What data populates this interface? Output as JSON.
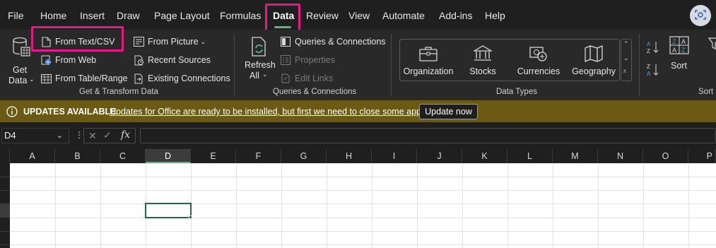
{
  "menu": {
    "tabs": [
      "File",
      "Home",
      "Insert",
      "Draw",
      "Page Layout",
      "Formulas",
      "Data",
      "Review",
      "View",
      "Automate",
      "Add-ins",
      "Help"
    ],
    "active_tab": "Data"
  },
  "ribbon": {
    "get_transform": {
      "get_data_line1": "Get",
      "get_data_line2": "Data",
      "from_text_csv": "From Text/CSV",
      "from_web": "From Web",
      "from_table_range": "From Table/Range",
      "from_picture": "From Picture",
      "recent_sources": "Recent Sources",
      "existing_connections": "Existing Connections",
      "group_label": "Get & Transform Data"
    },
    "queries": {
      "refresh_line1": "Refresh",
      "refresh_line2": "All",
      "queries_connections": "Queries & Connections",
      "properties": "Properties",
      "edit_links": "Edit Links",
      "group_label": "Queries & Connections"
    },
    "data_types": {
      "items": [
        "Organization",
        "Stocks",
        "Currencies",
        "Geography"
      ],
      "group_label": "Data Types"
    },
    "sort": {
      "sort_label": "Sort",
      "group_label": "Sort"
    }
  },
  "updates": {
    "title": "UPDATES AVAILABLE",
    "message": "Updates for Office are ready to be installed, but first we need to close some apps.",
    "button": "Update now"
  },
  "formula_bar": {
    "name_box": "D4",
    "fx": "fx",
    "formula": ""
  },
  "grid": {
    "columns": [
      "A",
      "B",
      "C",
      "D",
      "E",
      "F",
      "G",
      "H",
      "I",
      "J",
      "K",
      "L",
      "M",
      "N",
      "O",
      "P"
    ],
    "selected_column": "D",
    "selected_cell": "D4"
  },
  "colors": {
    "highlight": "#e8178a",
    "accent": "#5fb57d",
    "updates_bar": "#6b5a13"
  }
}
